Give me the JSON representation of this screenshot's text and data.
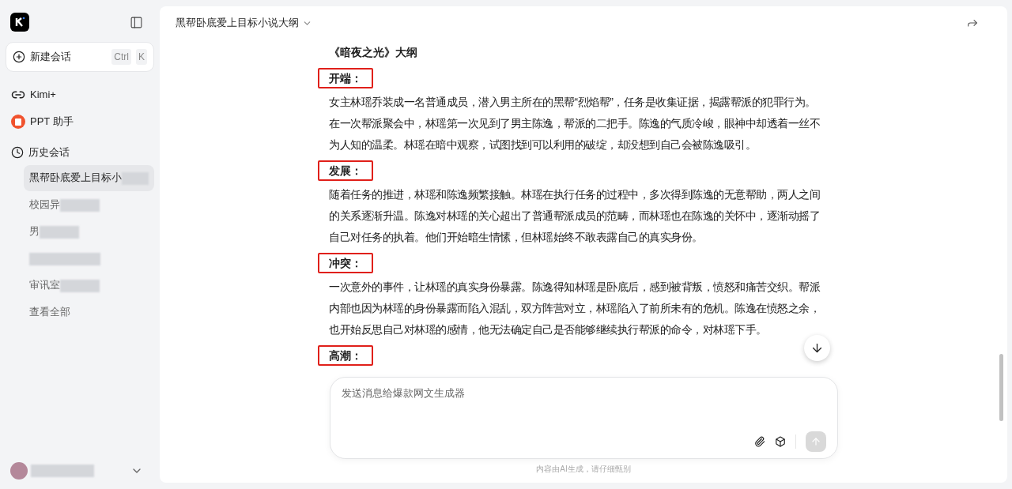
{
  "sidebar": {
    "new_chat": {
      "label": "新建会话",
      "keys": [
        "Ctrl",
        "K"
      ]
    },
    "nav": [
      {
        "kind": "kimi",
        "label": "Kimi+"
      },
      {
        "kind": "ppt",
        "label": "PPT 助手"
      }
    ],
    "history": {
      "label": "历史会话",
      "items": [
        {
          "text": "黑帮卧底爱上目标小",
          "selected": true
        },
        {
          "text": "校园异",
          "selected": false
        },
        {
          "text": "男",
          "selected": false
        },
        {
          "selected": false
        },
        {
          "text": "审讯室",
          "selected": false
        }
      ],
      "view_all": "查看全部"
    }
  },
  "header": {
    "title": "黑帮卧底爱上目标小说大纲"
  },
  "document": {
    "title": "《暗夜之光》大纲",
    "sections": [
      {
        "heading": "开端：",
        "body": "女主林瑶乔装成一名普通成员，潜入男主所在的黑帮“烈焰帮”，任务是收集证据，揭露帮派的犯罪行为。在一次帮派聚会中，林瑶第一次见到了男主陈逸，帮派的二把手。陈逸的气质冷峻，眼神中却透着一丝不为人知的温柔。林瑶在暗中观察，试图找到可以利用的破绽，却没想到自己会被陈逸吸引。"
      },
      {
        "heading": "发展：",
        "body": "随着任务的推进，林瑶和陈逸频繁接触。林瑶在执行任务的过程中，多次得到陈逸的无意帮助，两人之间的关系逐渐升温。陈逸对林瑶的关心超出了普通帮派成员的范畴，而林瑶也在陈逸的关怀中，逐渐动摇了自己对任务的执着。他们开始暗生情愫，但林瑶始终不敢表露自己的真实身份。"
      },
      {
        "heading": "冲突：",
        "body": "一次意外的事件，让林瑶的真实身份暴露。陈逸得知林瑶是卧底后，感到被背叛，愤怒和痛苦交织。帮派内部也因为林瑶的身份暴露而陷入混乱，双方阵营对立，林瑶陷入了前所未有的危机。陈逸在愤怒之余，也开始反思自己对林瑶的感情，他无法确定自己是否能够继续执行帮派的命令，对林瑶下手。"
      },
      {
        "heading": "高潮："
      }
    ]
  },
  "composer": {
    "placeholder": "发送消息给爆款网文生成器",
    "send_disabled": true
  },
  "disclaimer": "内容由AI生成，请仔细甄别"
}
